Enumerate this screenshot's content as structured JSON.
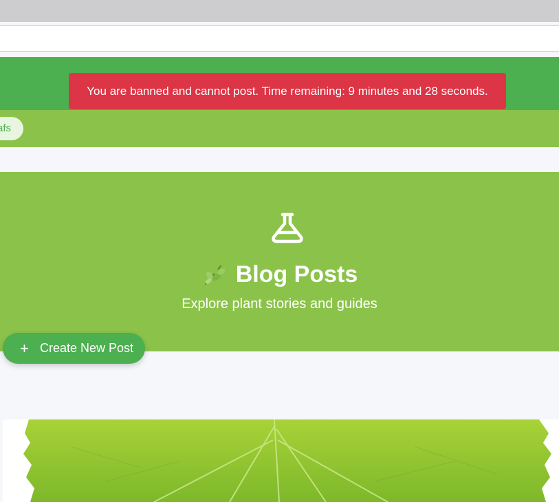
{
  "alert": {
    "message": "You are banned and cannot post. Time remaining: 9 minutes and 28 seconds."
  },
  "nav": {
    "pill_label": "afs"
  },
  "hero": {
    "icon": "flask-icon",
    "emoji": "leaf-emoji",
    "title": "Blog Posts",
    "subtitle": "Explore plant stories and guides"
  },
  "actions": {
    "create_label": "Create New Post",
    "create_icon": "plus-icon"
  },
  "post": {
    "image": "green-leaf-image"
  },
  "colors": {
    "header_green": "#4caf50",
    "nav_green": "#8bc34a",
    "alert_red": "#dc3545",
    "page_bg": "#f5f7fa"
  }
}
